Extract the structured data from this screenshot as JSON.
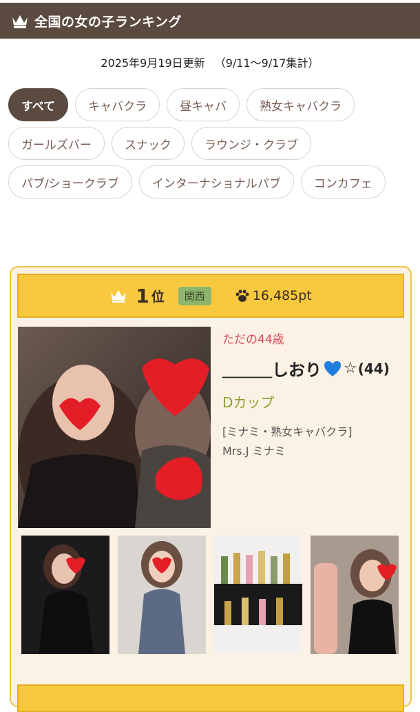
{
  "header": {
    "title": "全国の女の子ランキング"
  },
  "updated": {
    "date": "2025年9月19日更新",
    "period": "（9/11〜9/17集計）"
  },
  "tabs": [
    "すべて",
    "キャバクラ",
    "昼キャバ",
    "熟女キャバクラ",
    "ガールズバー",
    "スナック",
    "ラウンジ・クラブ",
    "パブ/ショークラブ",
    "インターナショナルパブ",
    "コンカフェ"
  ],
  "active_tab": "すべて",
  "ranking": [
    {
      "rank": "1",
      "rank_suffix": "位",
      "region": "関西",
      "points": "16,485pt",
      "catchphrase": "ただの44歳",
      "name_prefix": "＿＿＿しおり",
      "name_suffix": "☆",
      "age": "(44)",
      "cup": "Dカップ",
      "shop_category": "[ミナミ・熟女キャバクラ]",
      "shop_name": "Mrs.J ミナミ"
    }
  ],
  "colors": {
    "header_bg": "#5b4a3f",
    "accent_yellow": "#f8c93e",
    "catch_red": "#d9485b",
    "cup_green": "#8aa22d",
    "region_green": "#8cb66d"
  },
  "icons": [
    "crown-icon",
    "paw-icon",
    "blue-heart-icon"
  ]
}
